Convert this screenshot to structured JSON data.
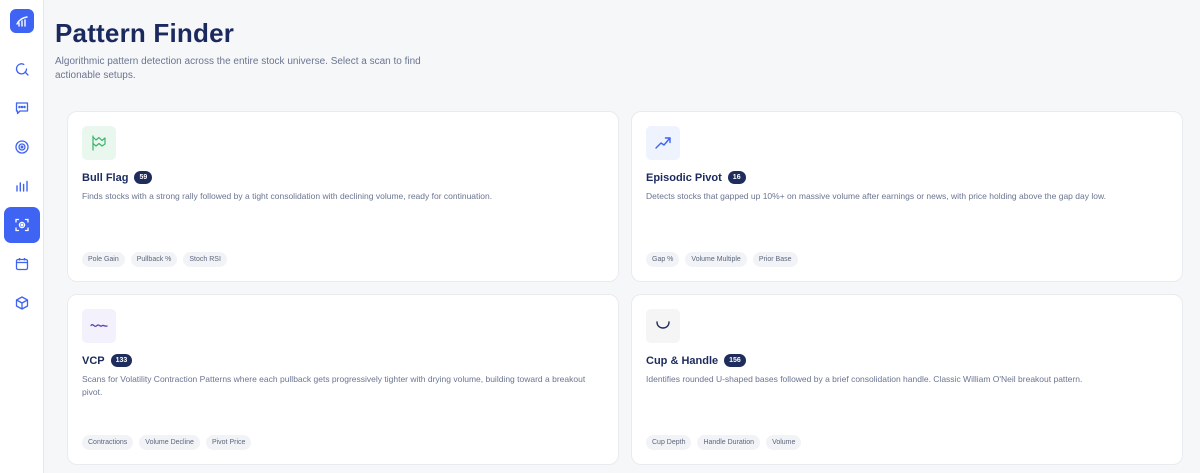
{
  "page": {
    "title": "Pattern Finder",
    "subtitle": "Algorithmic pattern detection across the entire stock universe. Select a scan to find actionable setups."
  },
  "sidebar": {
    "items": [
      {
        "icon": "search-refresh-icon"
      },
      {
        "icon": "chat-icon"
      },
      {
        "icon": "target-icon"
      },
      {
        "icon": "bar-chart-icon"
      },
      {
        "icon": "scan-icon",
        "active": true
      },
      {
        "icon": "calendar-icon"
      },
      {
        "icon": "cube-icon"
      }
    ]
  },
  "cards": [
    {
      "name": "Bull Flag",
      "count": "59",
      "description": "Finds stocks with a strong rally followed by a tight consolidation with declining volume, ready for continuation.",
      "tags": [
        "Pole Gain",
        "Pullback %",
        "Stoch RSI"
      ],
      "icon": "flag-icon",
      "icon_bg": "#eaf7ef",
      "icon_color": "#3db36b"
    },
    {
      "name": "Episodic Pivot",
      "count": "16",
      "description": "Detects stocks that gapped up 10%+ on massive volume after earnings or news, with price holding above the gap day low.",
      "tags": [
        "Gap %",
        "Volume Multiple",
        "Prior Base"
      ],
      "icon": "trend-up-icon",
      "icon_bg": "#eef3fd",
      "icon_color": "#3f63f2"
    },
    {
      "name": "VCP",
      "count": "133",
      "description": "Scans for Volatility Contraction Patterns where each pullback gets progressively tighter with drying volume, building toward a breakout pivot.",
      "tags": [
        "Contractions",
        "Volume Decline",
        "Pivot Price"
      ],
      "icon": "wave-icon",
      "icon_bg": "#f3f1fb",
      "icon_color": "#5b3fb0"
    },
    {
      "name": "Cup & Handle",
      "count": "156",
      "description": "Identifies rounded U-shaped bases followed by a brief consolidation handle. Classic William O'Neil breakout pattern.",
      "tags": [
        "Cup Depth",
        "Handle Duration",
        "Volume"
      ],
      "icon": "cup-icon",
      "icon_bg": "#f5f5f6",
      "icon_color": "#1f2d5c"
    }
  ],
  "colors": {
    "accent": "#3f63f2",
    "title": "#1b2a5e",
    "badge": "#1f2d5c"
  }
}
